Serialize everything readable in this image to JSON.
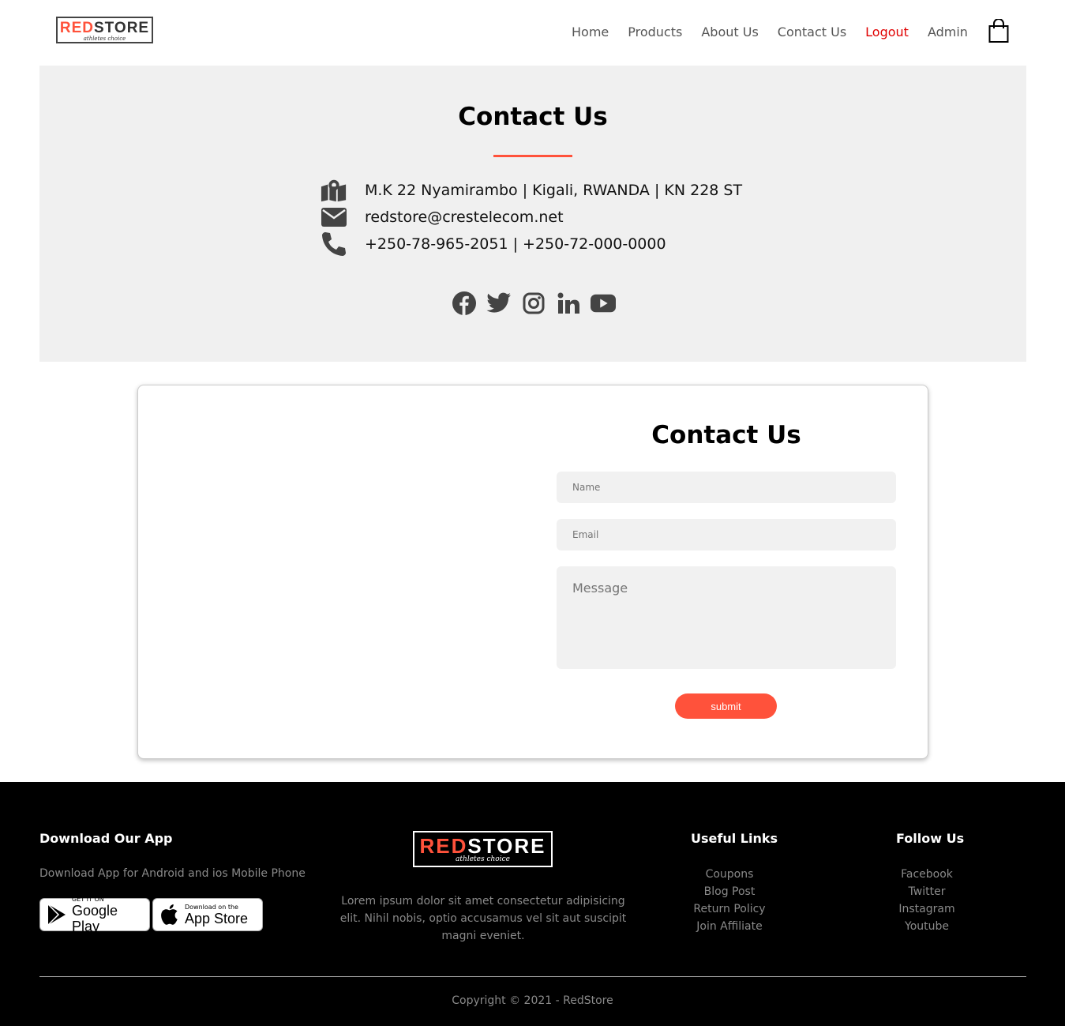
{
  "brand": {
    "logo_red": "RED",
    "logo_rest": "STORE",
    "tagline": "athletes choice"
  },
  "nav": {
    "items": [
      {
        "label": "Home"
      },
      {
        "label": "Products"
      },
      {
        "label": "About Us"
      },
      {
        "label": "Contact Us"
      },
      {
        "label": "Logout"
      },
      {
        "label": "Admin"
      }
    ],
    "cart_icon": "shopping-bag-icon"
  },
  "contact_band": {
    "title": "Contact Us",
    "address": "M.K 22 Nyamirambo | Kigali, RWANDA | KN 228 ST",
    "email": "redstore@crestelecom.net",
    "phone": "+250-78-965-2051 | +250-72-000-0000",
    "social_icons": [
      "facebook-icon",
      "twitter-icon",
      "instagram-icon",
      "linkedin-icon",
      "youtube-icon"
    ]
  },
  "form": {
    "title": "Contact Us",
    "name_placeholder": "Name",
    "email_placeholder": "Email",
    "message_placeholder": "Message",
    "submit_label": "submit"
  },
  "footer": {
    "app_title": "Download Our App",
    "app_text": "Download App for Android and ios Mobile Phone",
    "google_small": "GET IT ON",
    "google_big": "Google Play",
    "apple_small": "Download on the",
    "apple_big": "App Store",
    "about_text": "Lorem ipsum dolor sit amet consectetur adipisicing elit. Nihil nobis, optio accusamus vel sit aut suscipit magni eveniet.",
    "useful_title": "Useful Links",
    "useful_links": [
      "Coupons",
      "Blog Post",
      "Return Policy",
      "Join Affiliate"
    ],
    "follow_title": "Follow Us",
    "follow_links": [
      "Facebook",
      "Twitter",
      "Instagram",
      "Youtube"
    ],
    "copyright": "Copyright © 2021 - RedStore"
  },
  "colors": {
    "accent": "#ff523b",
    "logout": "#e00000",
    "band_bg": "#f0f0f0",
    "footer_bg": "#000000"
  }
}
